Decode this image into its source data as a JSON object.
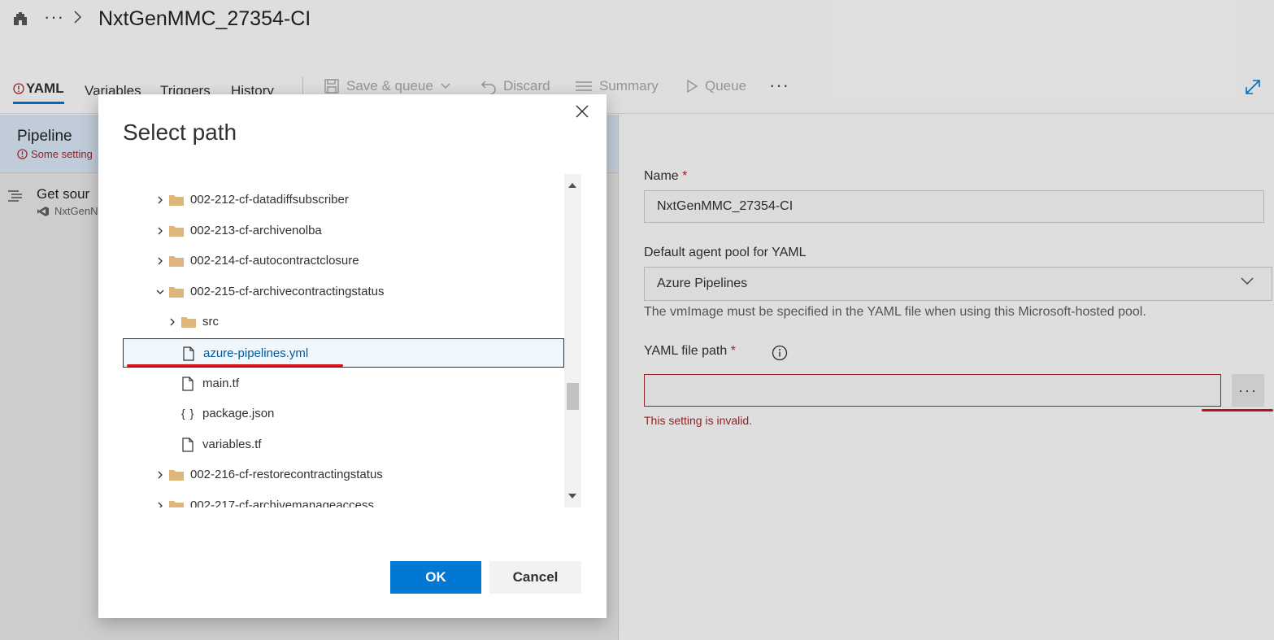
{
  "header": {
    "title": "NxtGenMMC_27354-CI",
    "overflow_label": "···"
  },
  "tabs": [
    {
      "label": "YAML"
    },
    {
      "label": "Variables"
    },
    {
      "label": "Triggers"
    },
    {
      "label": "History"
    }
  ],
  "toolbar": {
    "save_queue_label": "Save & queue",
    "discard_label": "Discard",
    "summary_label": "Summary",
    "queue_label": "Queue",
    "more_label": "···"
  },
  "left_panel": {
    "pipeline_title": "Pipeline",
    "pipeline_warning": "Some setting",
    "get_sources_title": "Get sour",
    "get_sources_subtitle": "NxtGenN"
  },
  "right_panel": {
    "name_label": "Name",
    "required_mark": "*",
    "name_value": "NxtGenMMC_27354-CI",
    "agent_pool_label": "Default agent pool for YAML",
    "agent_pool_value": "Azure Pipelines",
    "agent_pool_hint": "The vmImage must be specified in the YAML file when using this Microsoft-hosted pool.",
    "yaml_path_label": "YAML file path",
    "yaml_path_value": "",
    "browse_label": "···",
    "error_text": "This setting is invalid."
  },
  "dialog": {
    "title": "Select path",
    "ok_label": "OK",
    "cancel_label": "Cancel",
    "tree": [
      {
        "name": "002-212-cf-datadiffsubscriber",
        "type": "folder",
        "expanded": false,
        "level": 0
      },
      {
        "name": "002-213-cf-archivenolba",
        "type": "folder",
        "expanded": false,
        "level": 0
      },
      {
        "name": "002-214-cf-autocontractclosure",
        "type": "folder",
        "expanded": false,
        "level": 0
      },
      {
        "name": "002-215-cf-archivecontractingstatus",
        "type": "folder",
        "expanded": true,
        "level": 0
      },
      {
        "name": "src",
        "type": "folder",
        "expanded": false,
        "level": 1
      },
      {
        "name": "azure-pipelines.yml",
        "type": "file",
        "selected": true,
        "level": 1
      },
      {
        "name": "main.tf",
        "type": "file",
        "level": 1
      },
      {
        "name": "package.json",
        "type": "json",
        "level": 1
      },
      {
        "name": "variables.tf",
        "type": "file",
        "level": 1
      },
      {
        "name": "002-216-cf-restorecontractingstatus",
        "type": "folder",
        "expanded": false,
        "level": 0
      },
      {
        "name": "002-217-cf-archivemanageaccess",
        "type": "folder",
        "expanded": false,
        "level": 0
      }
    ]
  },
  "colors": {
    "accent": "#0078d4",
    "error": "#a4262c",
    "annotation": "#d3141e",
    "folder": "#dcb67a"
  },
  "icons": [
    "org-icon",
    "chevron-right-icon",
    "warning-icon",
    "save-icon",
    "chevron-down-icon",
    "undo-icon",
    "list-icon",
    "play-icon",
    "expand-icon",
    "close-icon",
    "folder-icon",
    "file-icon",
    "json-icon",
    "info-icon",
    "visual-studio-icon"
  ]
}
